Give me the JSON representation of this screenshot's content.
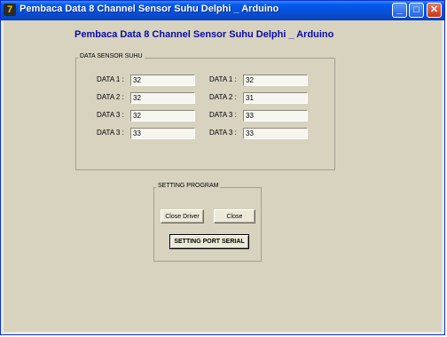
{
  "window": {
    "title": "Pembaca Data 8 Channel Sensor Suhu Delphi _ Arduino",
    "app_icon_glyph": "7",
    "buttons": {
      "minimize": "_",
      "maximize": "□",
      "close": "✕"
    }
  },
  "heading": "Pembaca Data 8 Channel Sensor Suhu Delphi _ Arduino",
  "sensor_group": {
    "label": "DATA SENSOR SUHU",
    "left": [
      {
        "label": "DATA 1 :",
        "value": "32"
      },
      {
        "label": "DATA 2 :",
        "value": "32"
      },
      {
        "label": "DATA 3 :",
        "value": "32"
      },
      {
        "label": "DATA 3 :",
        "value": "33"
      }
    ],
    "right": [
      {
        "label": "DATA 1 :",
        "value": "32"
      },
      {
        "label": "DATA 2 :",
        "value": "31"
      },
      {
        "label": "DATA 3 :",
        "value": "33"
      },
      {
        "label": "DATA 3 :",
        "value": "33"
      }
    ]
  },
  "settings_group": {
    "label": "SETTING PROGRAM",
    "close_driver": "Close Driver",
    "close": "Close",
    "setting_port": "SETTING PORT SERIAL"
  },
  "colors": {
    "heading": "#0b0ba8",
    "titlebar": "#0a4fd6",
    "form_bg": "#d7d3bf"
  }
}
